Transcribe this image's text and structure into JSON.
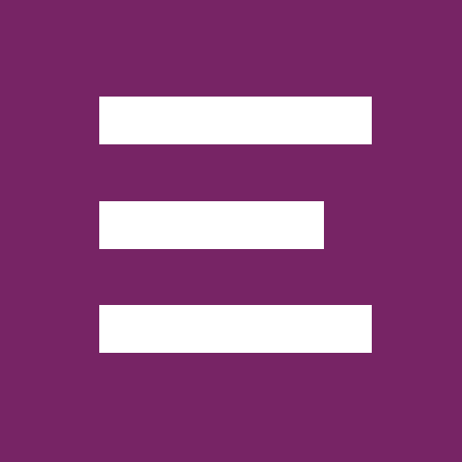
{
  "icon": {
    "name": "menu-lines-icon",
    "background_color": "#772465",
    "bar_color": "#FFFFFF"
  }
}
